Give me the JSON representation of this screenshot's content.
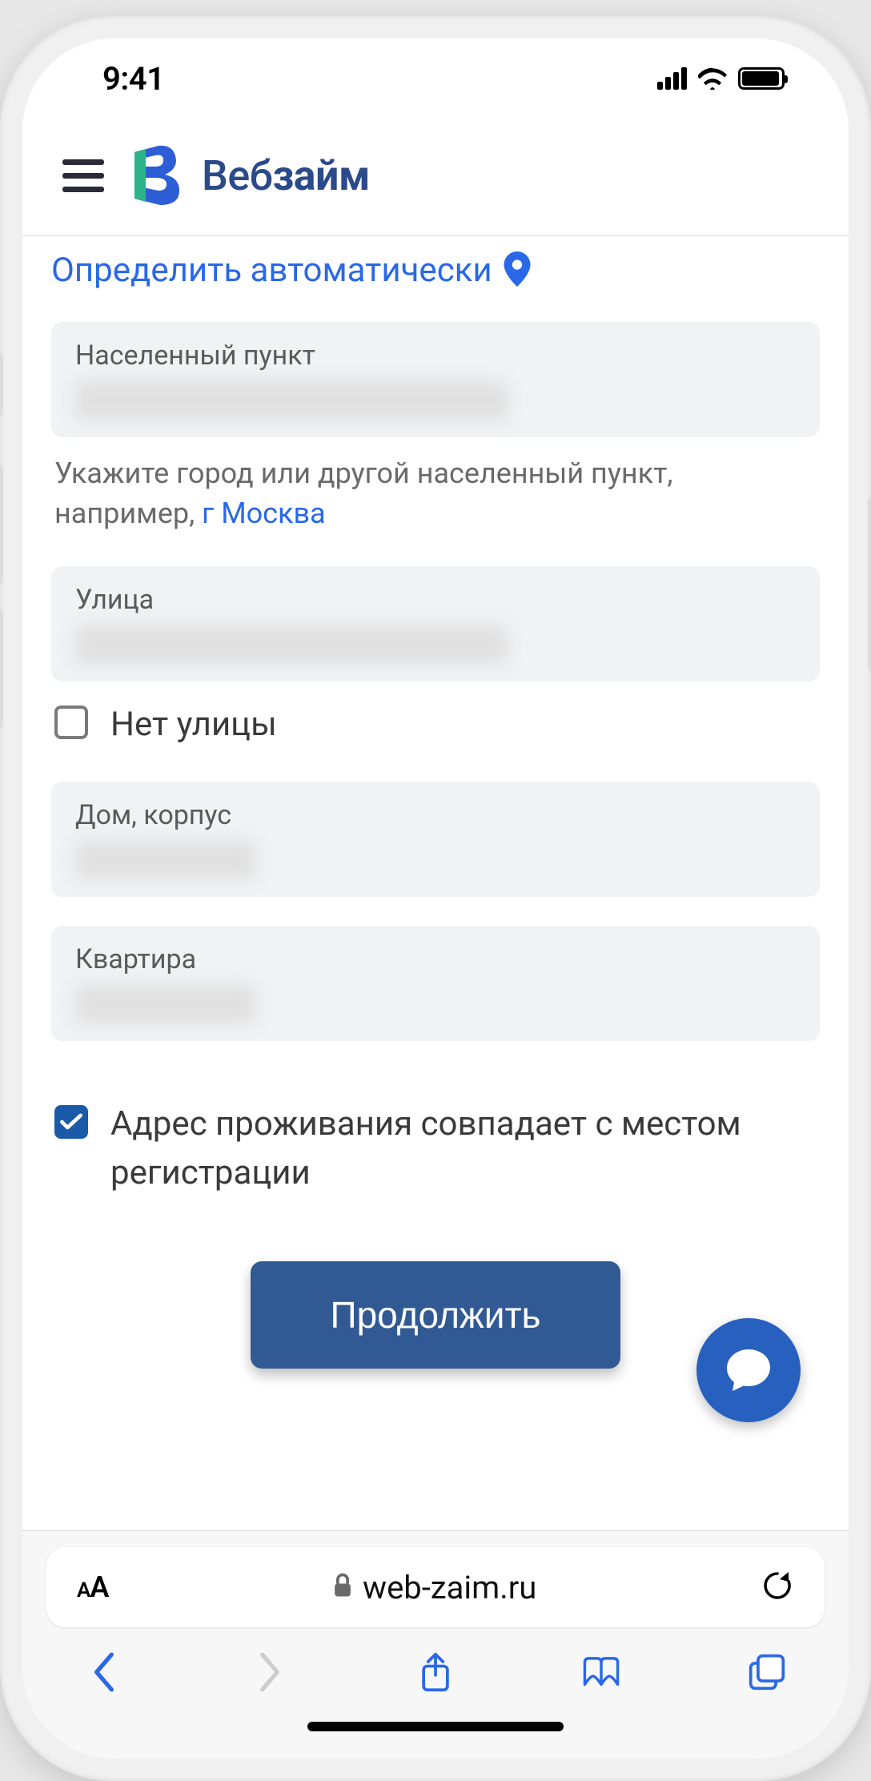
{
  "status": {
    "time": "9:41"
  },
  "header": {
    "brand_prefix": "Веб",
    "brand_suffix": "займ"
  },
  "auto_detect": "Определить автоматически",
  "fields": {
    "city_label": "Населенный пункт",
    "street_label": "Улица",
    "house_label": "Дом, корпус",
    "apt_label": "Квартира"
  },
  "hint": {
    "text": "Укажите город или другой населенный пункт, например, ",
    "link": "г Москва"
  },
  "no_street_label": "Нет улицы",
  "same_address_label": "Адрес проживания совпадает с местом регистрации",
  "continue_label": "Продолжить",
  "url": "web-zaim.ru",
  "url_aa": "A"
}
